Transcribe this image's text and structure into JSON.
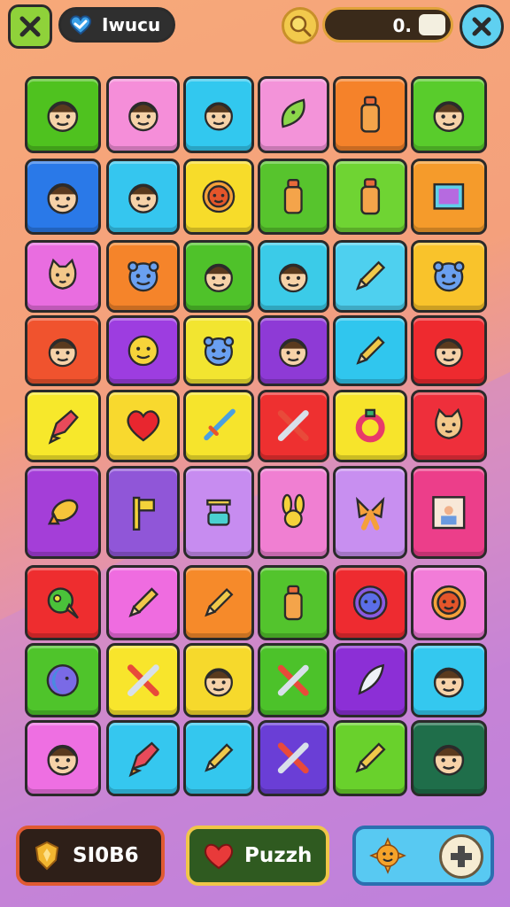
{
  "header": {
    "title": "Iwucu",
    "score_value": "0."
  },
  "bottom": {
    "coins_value": "SI0B6",
    "puzzle_label": "Puzzh"
  },
  "board": {
    "rows": 9,
    "cols": 6,
    "tiles": [
      {
        "color": "#4fc21f",
        "icon": "face-icon"
      },
      {
        "color": "#f58ed9",
        "icon": "face-icon"
      },
      {
        "color": "#32c8ef",
        "icon": "face-icon"
      },
      {
        "color": "#f393d9",
        "icon": "leaf-creature-icon"
      },
      {
        "color": "#f5822a",
        "icon": "bottle-icon"
      },
      {
        "color": "#59cc2c",
        "icon": "face-icon"
      },
      {
        "color": "#2a79e8",
        "icon": "face-icon"
      },
      {
        "color": "#35c6ef",
        "icon": "face-icon"
      },
      {
        "color": "#f7dc2a",
        "icon": "sun-face-icon"
      },
      {
        "color": "#57c42d",
        "icon": "bottle-icon"
      },
      {
        "color": "#6fd433",
        "icon": "bottle-icon"
      },
      {
        "color": "#f59b2b",
        "icon": "frame-icon"
      },
      {
        "color": "#e96de0",
        "icon": "cat-icon"
      },
      {
        "color": "#f5842a",
        "icon": "monster-icon"
      },
      {
        "color": "#4fc22a",
        "icon": "face-icon"
      },
      {
        "color": "#3bcbe8",
        "icon": "face-icon"
      },
      {
        "color": "#4ed0ef",
        "icon": "pencil-icon"
      },
      {
        "color": "#f9c32b",
        "icon": "monster-icon"
      },
      {
        "color": "#f0532e",
        "icon": "face-icon"
      },
      {
        "color": "#9d3de0",
        "icon": "smiley-icon"
      },
      {
        "color": "#f2e530",
        "icon": "monster-icon"
      },
      {
        "color": "#8e3ad6",
        "icon": "face-icon"
      },
      {
        "color": "#30c6ee",
        "icon": "pencil-icon"
      },
      {
        "color": "#ee2a2f",
        "icon": "face-icon"
      },
      {
        "color": "#f7e82b",
        "icon": "rocket-icon"
      },
      {
        "color": "#f8d92e",
        "icon": "heart-icon"
      },
      {
        "color": "#f6e42c",
        "icon": "sword-icon"
      },
      {
        "color": "#ee3030",
        "icon": "crossed-tools-icon"
      },
      {
        "color": "#f7e42b",
        "icon": "ring-icon"
      },
      {
        "color": "#ee2f3b",
        "icon": "cat-icon"
      },
      {
        "color": "#a43ed8",
        "icon": "fish-icon"
      },
      {
        "color": "#9056d8",
        "icon": "flag-icon"
      },
      {
        "color": "#c78cf0",
        "icon": "machine-icon"
      },
      {
        "color": "#f07fd2",
        "icon": "bunny-icon"
      },
      {
        "color": "#c88ff0",
        "icon": "bow-icon"
      },
      {
        "color": "#ec3e8a",
        "icon": "picture-icon"
      },
      {
        "color": "#ee2d2f",
        "icon": "bird-icon"
      },
      {
        "color": "#ef6ce0",
        "icon": "pencil-icon"
      },
      {
        "color": "#f68a2a",
        "icon": "pencil-icon"
      },
      {
        "color": "#53c42d",
        "icon": "bottle-icon"
      },
      {
        "color": "#ee2b30",
        "icon": "flower-face-icon"
      },
      {
        "color": "#f27cd8",
        "icon": "sun-face-icon"
      },
      {
        "color": "#4fc42b",
        "icon": "moon-face-icon"
      },
      {
        "color": "#f8e52c",
        "icon": "crossed-tools-icon"
      },
      {
        "color": "#f6d92c",
        "icon": "face-icon"
      },
      {
        "color": "#4cc22a",
        "icon": "crossed-tools-icon"
      },
      {
        "color": "#8c2fd6",
        "icon": "feather-icon"
      },
      {
        "color": "#34c8ef",
        "icon": "face-icon"
      },
      {
        "color": "#ee6fe2",
        "icon": "face-icon"
      },
      {
        "color": "#35c7ef",
        "icon": "rocket-icon"
      },
      {
        "color": "#34c7ee",
        "icon": "pencil-icon"
      },
      {
        "color": "#6a3ed6",
        "icon": "crossed-tools-icon"
      },
      {
        "color": "#69d12c",
        "icon": "pencil-icon"
      },
      {
        "color": "#1f6e4a",
        "icon": "face-icon"
      }
    ]
  }
}
